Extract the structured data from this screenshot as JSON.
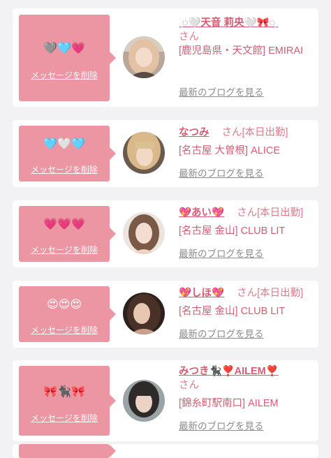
{
  "delete_label": "メッセージを削除",
  "blog_label": "最新のブログを見る",
  "colors": {
    "bubble": "#ec95a3",
    "name": "#d65c73",
    "link_gray": "#8d8d8d",
    "background": "#f2f2f4"
  },
  "items": [
    {
      "emoji": "🩶🩵💗",
      "name": "˳◌🤍天音 莉央🤍🎀◌˳",
      "san": "さん",
      "status": "",
      "shop": "[鹿児島県・天文館] EMIRAI"
    },
    {
      "emoji": "🩵🤍🩵",
      "name": "なつみ",
      "san": "さん",
      "status": "[本日出勤]",
      "shop": "[名古屋 大曽根] ALICE"
    },
    {
      "emoji": "💗💗💗",
      "name": "💖あい💖",
      "san": "さん",
      "status": "[本日出勤]",
      "shop": "[名古屋 金山] CLUB LIT"
    },
    {
      "emoji": "😍😍😍",
      "name": "💖しほ💖",
      "san": "さん",
      "status": "[本日出勤]",
      "shop": "[名古屋 金山] CLUB LIT"
    },
    {
      "emoji": "🎀🐈‍⬛🎀",
      "name": "みつき🐈‍⬛❣️AILEM❣️",
      "san": "さん",
      "status": "",
      "shop": "[錦糸町駅南口] AILEM"
    }
  ]
}
